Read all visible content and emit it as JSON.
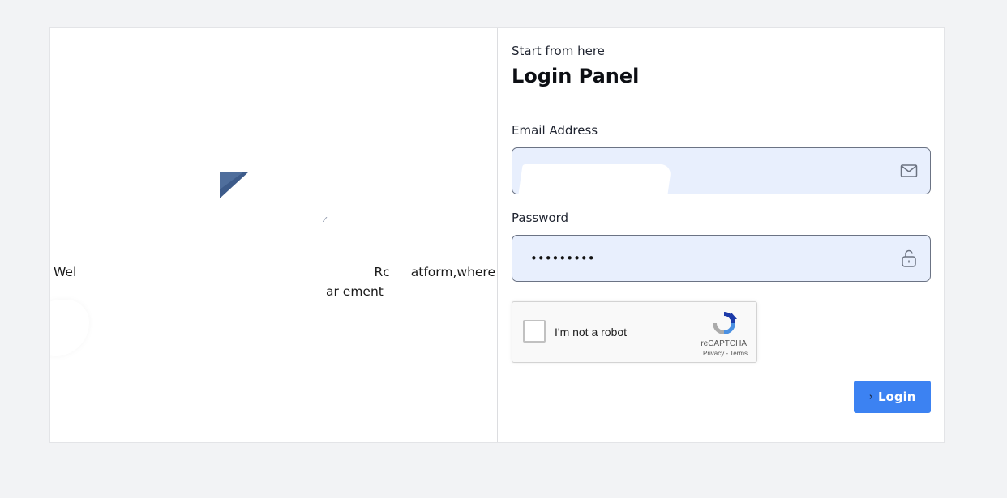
{
  "hero": {
    "welcome_line1_start": "Wel",
    "welcome_line1_mid": "Rc",
    "welcome_line1_end": "atform,where",
    "welcome_line2": "ar    ement"
  },
  "login": {
    "kicker": "Start from here",
    "title": "Login Panel",
    "email_label": "Email Address",
    "email_value": "",
    "password_label": "Password",
    "password_value": "•••••••••",
    "login_label": "Login"
  },
  "captcha": {
    "text": "I'm not a robot",
    "brand": "reCAPTCHA",
    "links": "Privacy - Terms"
  },
  "icons": {
    "email": "envelope-icon",
    "password": "lock-icon",
    "button": "chevron-right-icon",
    "captcha": "recaptcha-icon"
  },
  "colors": {
    "accent": "#3c82f2",
    "input_bg": "#e8effd",
    "page_bg": "#f2f3f5"
  }
}
